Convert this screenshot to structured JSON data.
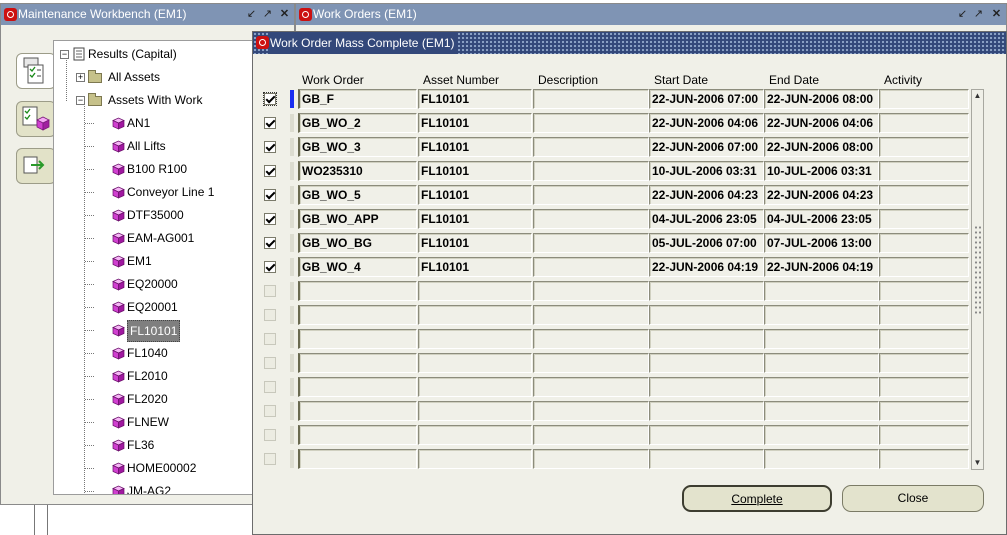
{
  "windows": {
    "workbench": {
      "title": "Maintenance Workbench (EM1)"
    },
    "work_orders": {
      "title": "Work Orders (EM1)"
    },
    "mass_complete": {
      "title": "Work Order Mass Complete (EM1)"
    }
  },
  "titlebar_controls": [
    "↙",
    "↗",
    "✕"
  ],
  "tree": {
    "root": "Results (Capital)",
    "all_assets": "All Assets",
    "assets_with_work": "Assets With Work",
    "items": [
      "AN1",
      "All Lifts",
      "B100 R100",
      "Conveyor Line 1",
      "DTF35000",
      "EAM-AG001",
      "EM1",
      "EQ20000",
      "EQ20001",
      "FL10101",
      "FL1040",
      "FL2010",
      "FL2020",
      "FLNEW",
      "FL36",
      "HOME00002",
      "JM-AG2"
    ],
    "selected": "FL10101"
  },
  "grid": {
    "columns": [
      "Work Order",
      "Asset Number",
      "Description",
      "Start Date",
      "End Date",
      "Activity"
    ],
    "rows": [
      {
        "checked": true,
        "work_order": "GB_F",
        "asset": "FL10101",
        "description": "",
        "start": "22-JUN-2006 07:00",
        "end": "22-JUN-2006 08:00",
        "activity": ""
      },
      {
        "checked": true,
        "work_order": "GB_WO_2",
        "asset": "FL10101",
        "description": "",
        "start": "22-JUN-2006 04:06",
        "end": "22-JUN-2006 04:06",
        "activity": ""
      },
      {
        "checked": true,
        "work_order": "GB_WO_3",
        "asset": "FL10101",
        "description": "",
        "start": "22-JUN-2006 07:00",
        "end": "22-JUN-2006 08:00",
        "activity": ""
      },
      {
        "checked": true,
        "work_order": "WO235310",
        "asset": "FL10101",
        "description": "",
        "start": "10-JUL-2006 03:31",
        "end": "10-JUL-2006 03:31",
        "activity": ""
      },
      {
        "checked": true,
        "work_order": "GB_WO_5",
        "asset": "FL10101",
        "description": "",
        "start": "22-JUN-2006 04:23",
        "end": "22-JUN-2006 04:23",
        "activity": ""
      },
      {
        "checked": true,
        "work_order": "GB_WO_APP",
        "asset": "FL10101",
        "description": "",
        "start": "04-JUL-2006 23:05",
        "end": "04-JUL-2006 23:05",
        "activity": ""
      },
      {
        "checked": true,
        "work_order": "GB_WO_BG",
        "asset": "FL10101",
        "description": "",
        "start": "05-JUL-2006 07:00",
        "end": "07-JUL-2006 13:00",
        "activity": ""
      },
      {
        "checked": true,
        "work_order": "GB_WO_4",
        "asset": "FL10101",
        "description": "",
        "start": "22-JUN-2006 04:19",
        "end": "22-JUN-2006 04:19",
        "activity": ""
      },
      {
        "checked": false,
        "work_order": "",
        "asset": "",
        "description": "",
        "start": "",
        "end": "",
        "activity": ""
      },
      {
        "checked": false,
        "work_order": "",
        "asset": "",
        "description": "",
        "start": "",
        "end": "",
        "activity": ""
      },
      {
        "checked": false,
        "work_order": "",
        "asset": "",
        "description": "",
        "start": "",
        "end": "",
        "activity": ""
      },
      {
        "checked": false,
        "work_order": "",
        "asset": "",
        "description": "",
        "start": "",
        "end": "",
        "activity": ""
      },
      {
        "checked": false,
        "work_order": "",
        "asset": "",
        "description": "",
        "start": "",
        "end": "",
        "activity": ""
      },
      {
        "checked": false,
        "work_order": "",
        "asset": "",
        "description": "",
        "start": "",
        "end": "",
        "activity": ""
      },
      {
        "checked": false,
        "work_order": "",
        "asset": "",
        "description": "",
        "start": "",
        "end": "",
        "activity": ""
      },
      {
        "checked": false,
        "work_order": "",
        "asset": "",
        "description": "",
        "start": "",
        "end": "",
        "activity": ""
      }
    ]
  },
  "buttons": {
    "complete": "Complete",
    "close": "Close"
  },
  "icons": {
    "tree_node": "magenta-cube-icon",
    "folder": "folder-icon",
    "window": "oracle-window-icon"
  },
  "colors": {
    "active_title": "#33487a",
    "inactive_title": "#7f94b4",
    "form_bg": "#f0f0e8",
    "focus_marker": "#1a2ef0",
    "node_cube": "#d040d0"
  }
}
